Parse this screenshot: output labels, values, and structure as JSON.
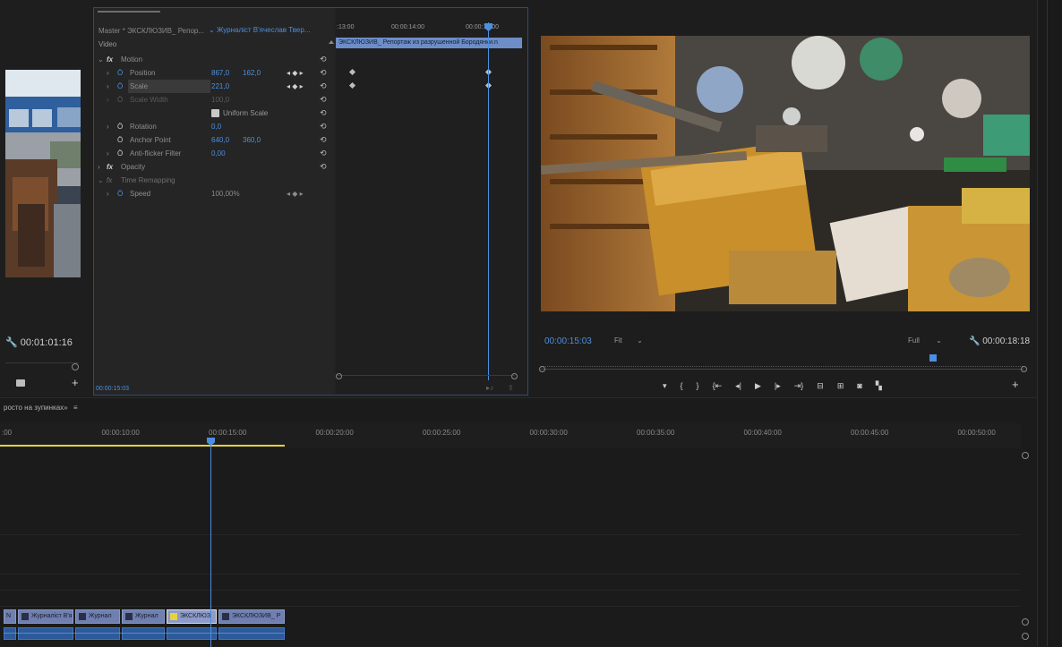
{
  "source": {
    "timecode": "00:01:01:16"
  },
  "effect_controls": {
    "master_label": "Master * ЭКСКЛЮЗИВ_ Репор...",
    "sequence_label": "Журналіст В'ячеслав Твер...",
    "clip_name": "ЭКСКЛЮЗИВ_ Репортаж из разрушенной Бородянки.n",
    "ruler_labels": [
      ":13:00",
      "00:00:14:00",
      "00:00:15:00"
    ],
    "video_label": "Video",
    "current_time": "00:00:15:03",
    "rows": [
      {
        "name": "Motion",
        "type": "section"
      },
      {
        "name": "Position",
        "v1": "867,0",
        "v2": "162,0"
      },
      {
        "name": "Scale",
        "v1": "221,0",
        "v2": ""
      },
      {
        "name": "Scale Width",
        "v1": "100,0",
        "v2": ""
      },
      {
        "name": "Uniform Scale",
        "type": "checkbox"
      },
      {
        "name": "Rotation",
        "v1": "0,0",
        "v2": ""
      },
      {
        "name": "Anchor Point",
        "v1": "640,0",
        "v2": "360,0"
      },
      {
        "name": "Anti-flicker Filter",
        "v1": "0,00",
        "v2": ""
      },
      {
        "name": "Opacity",
        "type": "section"
      },
      {
        "name": "Time Remapping",
        "type": "section"
      },
      {
        "name": "Speed",
        "v1": "100,00%",
        "v2": ""
      }
    ]
  },
  "program": {
    "timecode": "00:00:15:03",
    "fit": "Fit",
    "quality": "Full",
    "duration": "00:00:18:18"
  },
  "timeline": {
    "sequence_name": "росто на зупинках»",
    "ruler": [
      {
        "label": ":00",
        "pos": 0
      },
      {
        "label": "00:00:10:00",
        "pos": 1
      },
      {
        "label": "00:00:15:00",
        "pos": 2
      },
      {
        "label": "00:00:20:00",
        "pos": 3
      },
      {
        "label": "00:00:25:00",
        "pos": 4
      },
      {
        "label": "00:00:30:00",
        "pos": 5
      },
      {
        "label": "00:00:35:00",
        "pos": 6
      },
      {
        "label": "00:00:40:00",
        "pos": 7
      },
      {
        "label": "00:00:45:00",
        "pos": 8
      },
      {
        "label": "00:00:50:00",
        "pos": 9
      }
    ],
    "clips": [
      "Журналіст В'я",
      "Журнал",
      "Журнал",
      "ЭКСКЛЮЗ",
      "ЭКСКЛЮЗИВ_ Р"
    ]
  },
  "colors": {
    "accent": "#4c8fe0",
    "clip": "#6f7fb0",
    "audio": "#2c5a9a",
    "workarea": "#e6d23a"
  }
}
